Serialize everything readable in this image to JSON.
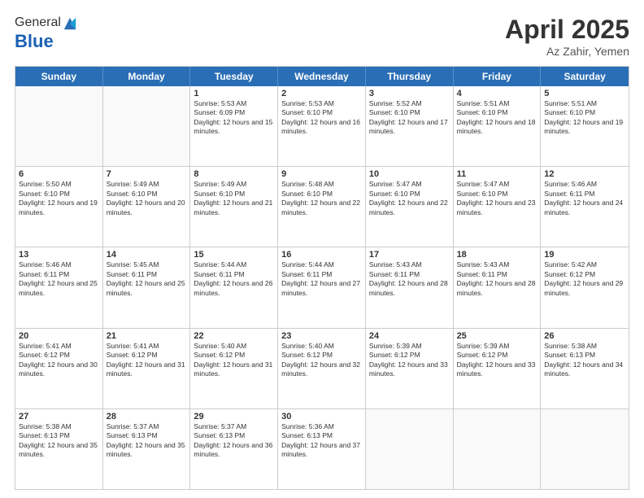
{
  "header": {
    "logo_general": "General",
    "logo_blue": "Blue",
    "month_year": "April 2025",
    "location": "Az Zahir, Yemen"
  },
  "weekdays": [
    "Sunday",
    "Monday",
    "Tuesday",
    "Wednesday",
    "Thursday",
    "Friday",
    "Saturday"
  ],
  "rows": [
    [
      {
        "day": "",
        "info": ""
      },
      {
        "day": "",
        "info": ""
      },
      {
        "day": "1",
        "info": "Sunrise: 5:53 AM\nSunset: 6:09 PM\nDaylight: 12 hours and 15 minutes."
      },
      {
        "day": "2",
        "info": "Sunrise: 5:53 AM\nSunset: 6:10 PM\nDaylight: 12 hours and 16 minutes."
      },
      {
        "day": "3",
        "info": "Sunrise: 5:52 AM\nSunset: 6:10 PM\nDaylight: 12 hours and 17 minutes."
      },
      {
        "day": "4",
        "info": "Sunrise: 5:51 AM\nSunset: 6:10 PM\nDaylight: 12 hours and 18 minutes."
      },
      {
        "day": "5",
        "info": "Sunrise: 5:51 AM\nSunset: 6:10 PM\nDaylight: 12 hours and 19 minutes."
      }
    ],
    [
      {
        "day": "6",
        "info": "Sunrise: 5:50 AM\nSunset: 6:10 PM\nDaylight: 12 hours and 19 minutes."
      },
      {
        "day": "7",
        "info": "Sunrise: 5:49 AM\nSunset: 6:10 PM\nDaylight: 12 hours and 20 minutes."
      },
      {
        "day": "8",
        "info": "Sunrise: 5:49 AM\nSunset: 6:10 PM\nDaylight: 12 hours and 21 minutes."
      },
      {
        "day": "9",
        "info": "Sunrise: 5:48 AM\nSunset: 6:10 PM\nDaylight: 12 hours and 22 minutes."
      },
      {
        "day": "10",
        "info": "Sunrise: 5:47 AM\nSunset: 6:10 PM\nDaylight: 12 hours and 22 minutes."
      },
      {
        "day": "11",
        "info": "Sunrise: 5:47 AM\nSunset: 6:10 PM\nDaylight: 12 hours and 23 minutes."
      },
      {
        "day": "12",
        "info": "Sunrise: 5:46 AM\nSunset: 6:11 PM\nDaylight: 12 hours and 24 minutes."
      }
    ],
    [
      {
        "day": "13",
        "info": "Sunrise: 5:46 AM\nSunset: 6:11 PM\nDaylight: 12 hours and 25 minutes."
      },
      {
        "day": "14",
        "info": "Sunrise: 5:45 AM\nSunset: 6:11 PM\nDaylight: 12 hours and 25 minutes."
      },
      {
        "day": "15",
        "info": "Sunrise: 5:44 AM\nSunset: 6:11 PM\nDaylight: 12 hours and 26 minutes."
      },
      {
        "day": "16",
        "info": "Sunrise: 5:44 AM\nSunset: 6:11 PM\nDaylight: 12 hours and 27 minutes."
      },
      {
        "day": "17",
        "info": "Sunrise: 5:43 AM\nSunset: 6:11 PM\nDaylight: 12 hours and 28 minutes."
      },
      {
        "day": "18",
        "info": "Sunrise: 5:43 AM\nSunset: 6:11 PM\nDaylight: 12 hours and 28 minutes."
      },
      {
        "day": "19",
        "info": "Sunrise: 5:42 AM\nSunset: 6:12 PM\nDaylight: 12 hours and 29 minutes."
      }
    ],
    [
      {
        "day": "20",
        "info": "Sunrise: 5:41 AM\nSunset: 6:12 PM\nDaylight: 12 hours and 30 minutes."
      },
      {
        "day": "21",
        "info": "Sunrise: 5:41 AM\nSunset: 6:12 PM\nDaylight: 12 hours and 31 minutes."
      },
      {
        "day": "22",
        "info": "Sunrise: 5:40 AM\nSunset: 6:12 PM\nDaylight: 12 hours and 31 minutes."
      },
      {
        "day": "23",
        "info": "Sunrise: 5:40 AM\nSunset: 6:12 PM\nDaylight: 12 hours and 32 minutes."
      },
      {
        "day": "24",
        "info": "Sunrise: 5:39 AM\nSunset: 6:12 PM\nDaylight: 12 hours and 33 minutes."
      },
      {
        "day": "25",
        "info": "Sunrise: 5:39 AM\nSunset: 6:12 PM\nDaylight: 12 hours and 33 minutes."
      },
      {
        "day": "26",
        "info": "Sunrise: 5:38 AM\nSunset: 6:13 PM\nDaylight: 12 hours and 34 minutes."
      }
    ],
    [
      {
        "day": "27",
        "info": "Sunrise: 5:38 AM\nSunset: 6:13 PM\nDaylight: 12 hours and 35 minutes."
      },
      {
        "day": "28",
        "info": "Sunrise: 5:37 AM\nSunset: 6:13 PM\nDaylight: 12 hours and 35 minutes."
      },
      {
        "day": "29",
        "info": "Sunrise: 5:37 AM\nSunset: 6:13 PM\nDaylight: 12 hours and 36 minutes."
      },
      {
        "day": "30",
        "info": "Sunrise: 5:36 AM\nSunset: 6:13 PM\nDaylight: 12 hours and 37 minutes."
      },
      {
        "day": "",
        "info": ""
      },
      {
        "day": "",
        "info": ""
      },
      {
        "day": "",
        "info": ""
      }
    ]
  ]
}
